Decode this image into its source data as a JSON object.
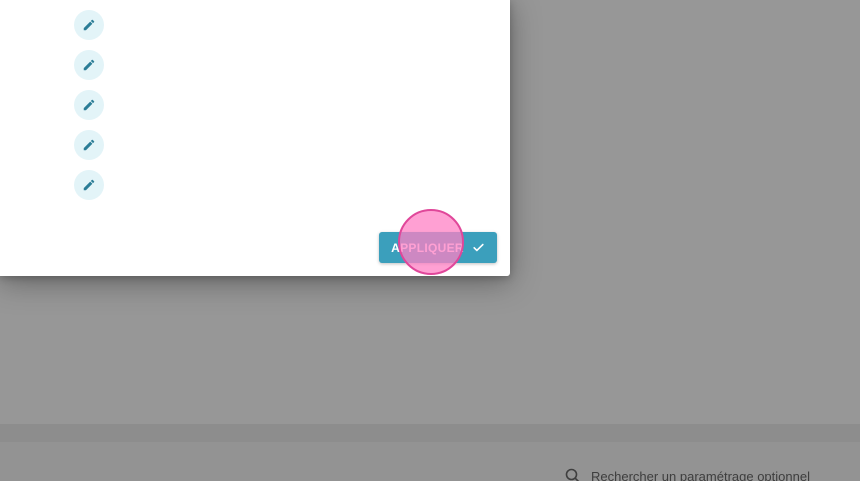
{
  "modal": {
    "edit_buttons": [
      {
        "icon": "pencil-icon"
      },
      {
        "icon": "pencil-icon"
      },
      {
        "icon": "pencil-icon"
      },
      {
        "icon": "pencil-icon"
      },
      {
        "icon": "pencil-icon"
      }
    ],
    "apply_label": "APPLIQUER",
    "apply_icon": "check-icon"
  },
  "background": {
    "search_placeholder": "Rechercher un paramétrage optionnel",
    "search_icon": "search-icon"
  },
  "colors": {
    "accent": "#3b9fbc",
    "edit_icon_bg": "#e3f4f8",
    "overlay": "#979797",
    "click_indicator": "#ff80c4"
  }
}
